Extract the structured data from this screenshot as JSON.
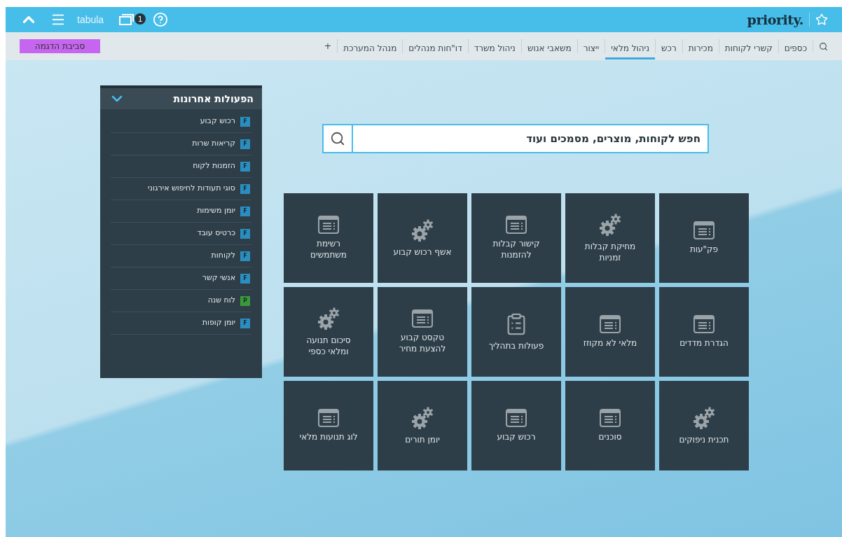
{
  "header": {
    "company": "tabula",
    "open_windows_count": "1",
    "logo": "priority."
  },
  "nav": {
    "items": [
      {
        "label": "כספים",
        "selected": false
      },
      {
        "label": "קשרי לקוחות",
        "selected": false
      },
      {
        "label": "מכירות",
        "selected": false
      },
      {
        "label": "רכש",
        "selected": false
      },
      {
        "label": "ניהול מלאי",
        "selected": true
      },
      {
        "label": "ייצור",
        "selected": false
      },
      {
        "label": "משאבי אנוש",
        "selected": false
      },
      {
        "label": "ניהול משרד",
        "selected": false
      },
      {
        "label": "דו\"חות מנהלים",
        "selected": false
      },
      {
        "label": "מנהל המערכת",
        "selected": false
      }
    ],
    "add": "+",
    "environment": "סביבת הדגמה"
  },
  "recent": {
    "title": "הפעולות אחרונות",
    "expanded": true,
    "items": [
      {
        "label": "רכוש קבוע",
        "badge": "F",
        "color": "#2a8fc0"
      },
      {
        "label": "קריאות שרות",
        "badge": "F",
        "color": "#2a8fc0"
      },
      {
        "label": "הזמנות לקוח",
        "badge": "F",
        "color": "#2a8fc0"
      },
      {
        "label": "סוגי תעודות לחיפוש אירגוני",
        "badge": "F",
        "color": "#2a8fc0"
      },
      {
        "label": "יומן משימות",
        "badge": "F",
        "color": "#2a8fc0"
      },
      {
        "label": "כרטיס עובד",
        "badge": "F",
        "color": "#2a8fc0"
      },
      {
        "label": "לקוחות",
        "badge": "F",
        "color": "#2a8fc0"
      },
      {
        "label": "אנשי קשר",
        "badge": "F",
        "color": "#2a8fc0"
      },
      {
        "label": "לוח שנה",
        "badge": "P",
        "color": "#3a9a3a"
      },
      {
        "label": "יומן קופות",
        "badge": "F",
        "color": "#2a8fc0"
      }
    ]
  },
  "search": {
    "placeholder": "חפש לקוחות, מוצרים, מסמכים ועוד"
  },
  "tiles": [
    {
      "label": "פק\"עות",
      "kind": "form"
    },
    {
      "label": "מחיקת קבלות זמניות",
      "kind": "procedure"
    },
    {
      "label": "קישור קבלות להזמנות",
      "kind": "form"
    },
    {
      "label": "אשף רכוש קבוע",
      "kind": "procedure"
    },
    {
      "label": "רשימת משתמשים",
      "kind": "form"
    },
    {
      "label": "הגדרת מדדים",
      "kind": "form"
    },
    {
      "label": "מלאי לא מקוזז",
      "kind": "form"
    },
    {
      "label": "פעולות בתהליך",
      "kind": "report"
    },
    {
      "label": "טקסט קבוע להצעת מחיר",
      "kind": "form"
    },
    {
      "label": "סיכום תנועה ומלאי כספי",
      "kind": "procedure"
    },
    {
      "label": "תכנית ניפוקים",
      "kind": "procedure"
    },
    {
      "label": "סוכנים",
      "kind": "form"
    },
    {
      "label": "רכוש קבוע",
      "kind": "form"
    },
    {
      "label": "יומן תורים",
      "kind": "procedure"
    },
    {
      "label": "לוג תנועות מלאי",
      "kind": "form"
    }
  ]
}
